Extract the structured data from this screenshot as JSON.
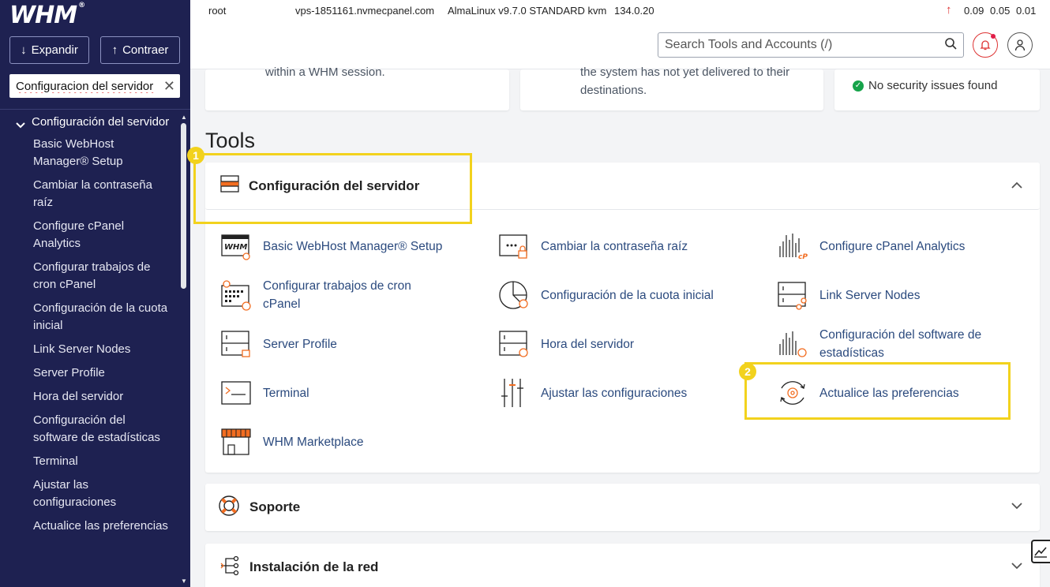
{
  "sidebar": {
    "logo": "WHM",
    "expand_label": "Expandir",
    "collapse_label": "Contraer",
    "search_value": "Configuracion del servidor",
    "category": "Configuración del servidor",
    "items": [
      "Basic WebHost Manager® Setup",
      "Cambiar la contraseña raíz",
      "Configure cPanel Analytics",
      "Configurar trabajos de cron cPanel",
      "Configuración de la cuota inicial",
      "Link Server Nodes",
      "Server Profile",
      "Hora del servidor",
      "Configuración del software de estadísticas",
      "Terminal",
      "Ajustar las configuraciones",
      "Actualice las preferencias"
    ]
  },
  "topbar": {
    "user": "root",
    "hostname": "vps-1851161.nvmecpanel.com",
    "os": "AlmaLinux v9.7.0 STANDARD kvm",
    "version": "134.0.20",
    "load": [
      "0.09",
      "0.05",
      "0.01"
    ]
  },
  "header": {
    "search_placeholder": "Search Tools and Accounts (/)"
  },
  "cards": {
    "card1_text": "within a WHM session.",
    "card2_text": "the system has not yet delivered to their destinations.",
    "card3_text": "No security issues found"
  },
  "tools_title": "Tools",
  "panels": {
    "server_config": "Configuración del servidor",
    "support": "Soporte",
    "network": "Instalación de la red"
  },
  "tools": {
    "basic_setup": "Basic WebHost Manager® Setup",
    "change_root_pw": "Cambiar la contraseña raíz",
    "cpanel_analytics": "Configure cPanel Analytics",
    "cron_jobs": "Configurar trabajos de cron cPanel",
    "initial_quota": "Configuración de la cuota inicial",
    "link_nodes": "Link Server Nodes",
    "server_profile": "Server Profile",
    "server_time": "Hora del servidor",
    "stats_software": "Configuración del software de estadísticas",
    "terminal": "Terminal",
    "tweak_settings": "Ajustar las configuraciones",
    "update_prefs": "Actualice las preferencias",
    "marketplace": "WHM Marketplace"
  },
  "badges": [
    "1",
    "2"
  ],
  "colors": {
    "sidebar": "#1e2151",
    "link": "#2b4a7e",
    "accent": "#f26d21",
    "highlight": "#f2d21d"
  }
}
